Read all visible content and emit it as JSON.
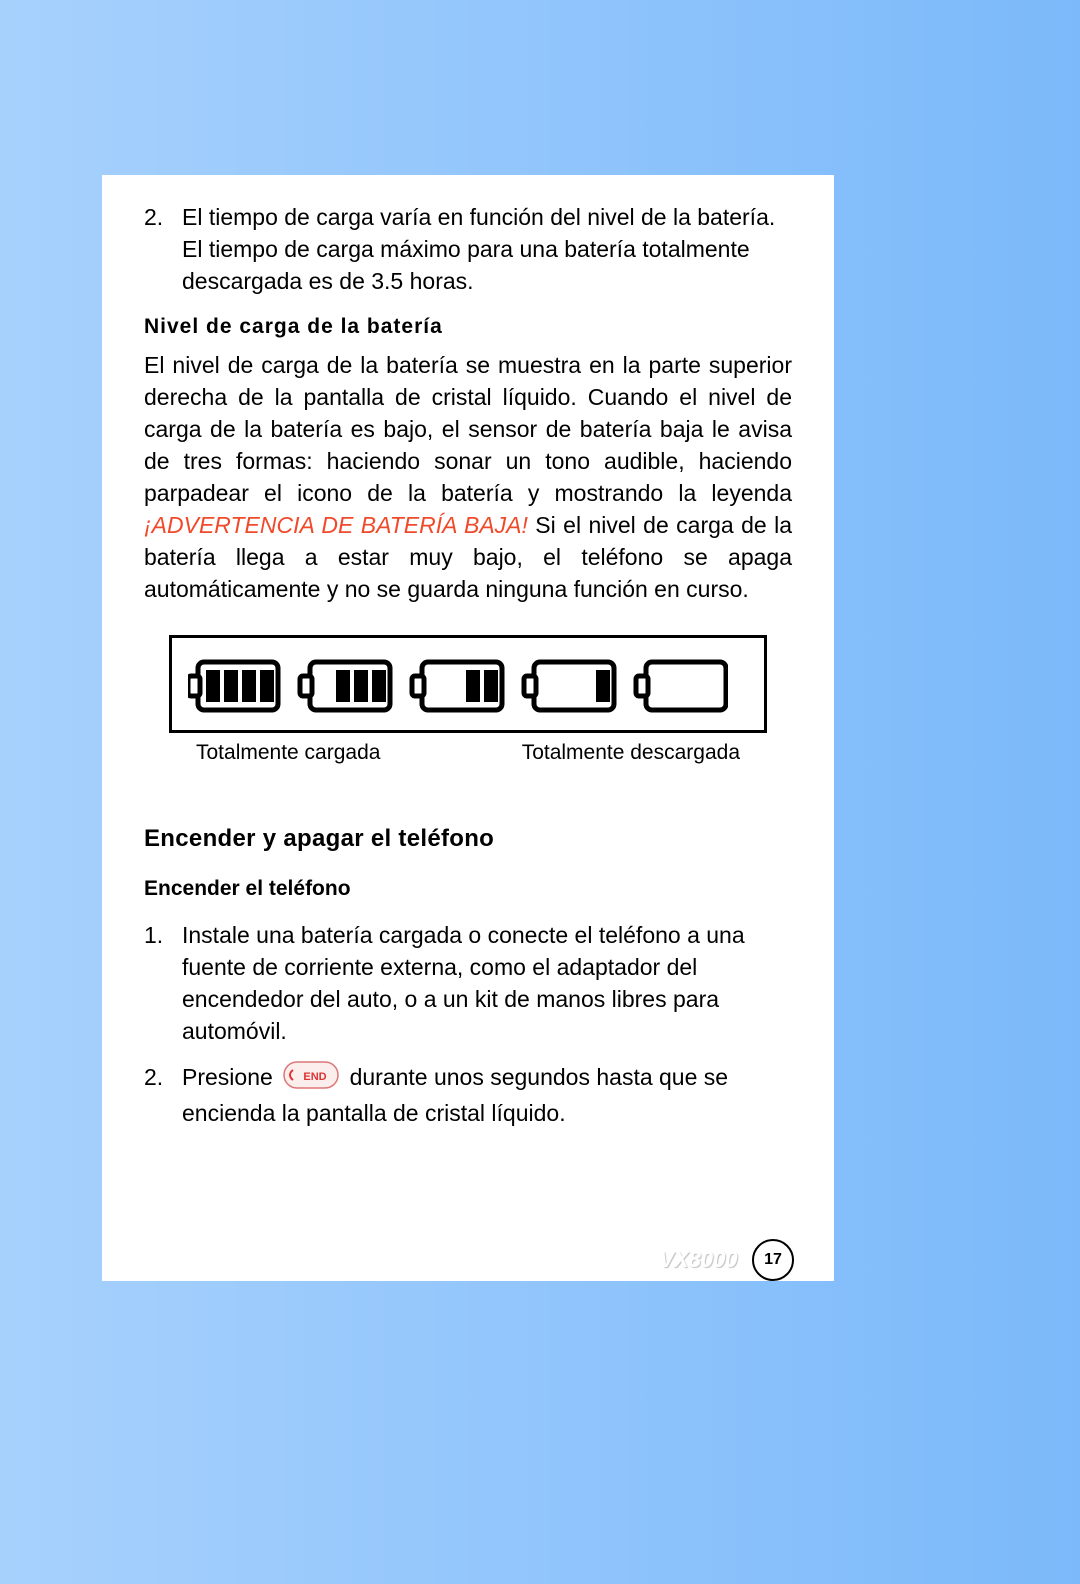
{
  "item2": {
    "num": "2.",
    "text": "El tiempo de carga varía en función del nivel de la batería. El tiempo de carga máximo para una batería totalmente descargada es de 3.5 horas."
  },
  "section_battery_level": {
    "heading": "Nivel de carga de la batería",
    "para_before_warning": "El nivel de carga de la batería se muestra en la parte superior derecha de la pantalla de cristal líquido. Cuando el nivel de carga de la batería es bajo, el sensor de batería baja le avisa de tres formas: haciendo sonar un tono audible, haciendo parpadear el icono de la batería y mostrando la leyenda ",
    "warning": "¡ADVERTENCIA DE BATERÍA BAJA!",
    "para_after_warning": " Si el nivel de carga de la batería llega a estar muy bajo, el teléfono se apaga automáticamente y no se guarda ninguna función en curso."
  },
  "battery_captions": {
    "full": "Totalmente cargada",
    "empty": "Totalmente descargada"
  },
  "section_power": {
    "heading": "Encender y apagar el teléfono",
    "sub_on": "Encender el teléfono",
    "steps": [
      {
        "num": "1.",
        "text": "Instale una batería cargada o conecte el teléfono a una fuente de corriente externa, como el adaptador del encendedor del auto, o a un kit de manos libres para automóvil."
      },
      {
        "num": "2.",
        "pre": "Presione ",
        "post": " durante unos segundos hasta que se encienda la pantalla de cristal líquido."
      }
    ]
  },
  "footer": {
    "model": "VX8000",
    "page": "17"
  },
  "icons": {
    "end_key_label": "END"
  }
}
